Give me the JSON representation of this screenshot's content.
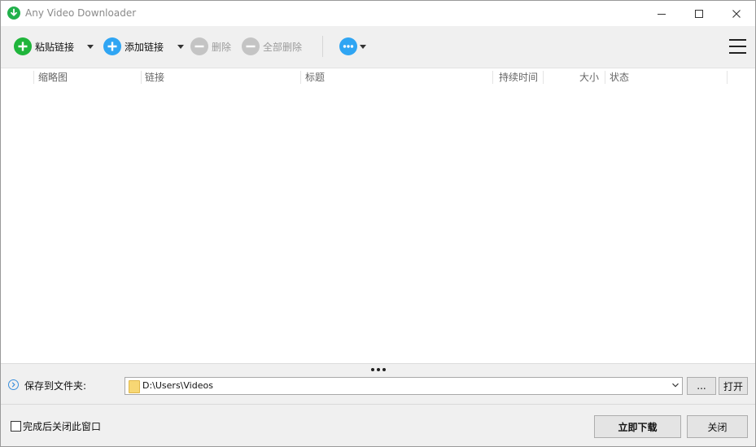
{
  "window": {
    "title": "Any Video Downloader"
  },
  "toolbar": {
    "paste_link": "粘贴链接",
    "add_link": "添加链接",
    "delete": "删除",
    "delete_all": "全部删除"
  },
  "list": {
    "columns": [
      "缩略图",
      "链接",
      "标题",
      "持续时间",
      "大小",
      "状态"
    ]
  },
  "save": {
    "label": "保存到文件夹:",
    "path": "D:\\Users\\Videos",
    "browse_label": "...",
    "open_label": "打开"
  },
  "footer": {
    "close_after_label": "完成后关闭此窗口",
    "close_after_checked": false,
    "download_now_label": "立即下载",
    "close_label": "关闭"
  },
  "colors": {
    "paste_icon": "#1fb53b",
    "add_icon": "#2fa5f3",
    "disabled_icon": "#c4c4c4",
    "more_icon": "#2fa5f3",
    "app_icon": "#22b14c"
  },
  "icons": {
    "app": "download-arrow-icon",
    "paste": "plus-circle-icon",
    "add": "plus-circle-icon",
    "delete": "minus-circle-icon",
    "delete_all": "minus-circle-icon",
    "more": "ellipsis-circle-icon",
    "menu": "hamburger-menu-icon"
  }
}
